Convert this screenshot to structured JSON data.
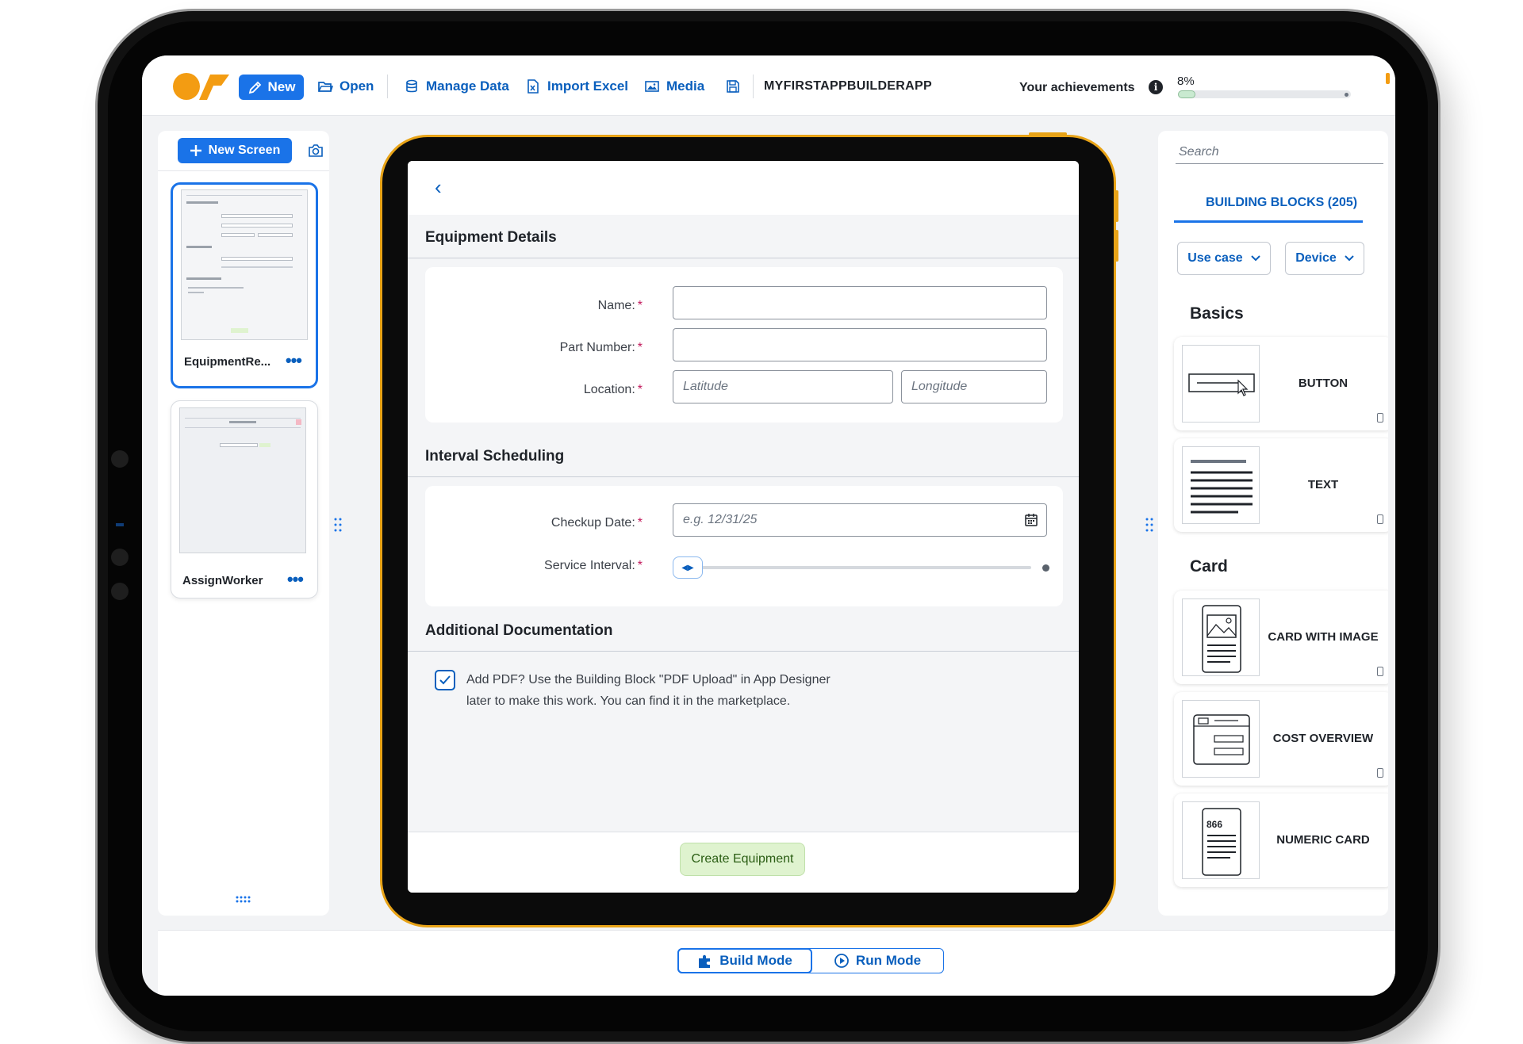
{
  "toolbar": {
    "new_label": "New",
    "open_label": "Open",
    "manage_data_label": "Manage Data",
    "import_excel_label": "Import Excel",
    "media_label": "Media",
    "app_name": "MYFIRSTAPPBUILDERAPP",
    "achievements_label": "Your achievements",
    "achievements_info": "i",
    "achievements_percent": "8%",
    "achievements_progress": 0.08
  },
  "screens_panel": {
    "new_screen_label": "New Screen",
    "screens": [
      {
        "name": "EquipmentRe...",
        "more": "•••",
        "selected": true
      },
      {
        "name": "AssignWorker",
        "more": "•••",
        "selected": false
      }
    ]
  },
  "preview": {
    "back_icon": "‹",
    "sections": {
      "equipment_title": "Equipment Details",
      "interval_title": "Interval Scheduling",
      "documentation_title": "Additional Documentation"
    },
    "fields": {
      "name_label": "Name:",
      "part_number_label": "Part Number:",
      "location_label": "Location:",
      "latitude_placeholder": "Latitude",
      "longitude_placeholder": "Longitude",
      "checkup_date_label": "Checkup Date:",
      "checkup_date_placeholder": "e.g. 12/31/25",
      "service_interval_label": "Service Interval:",
      "required_mark": "*"
    },
    "documentation": {
      "checkbox_checked": true,
      "line1": "Add PDF? Use the Building Block \"PDF Upload\" in App Designer",
      "line2": "later to make this work. You can find it in the marketplace."
    },
    "create_button": "Create Equipment"
  },
  "blocks_panel": {
    "search_placeholder": "Search",
    "tab_label": "BUILDING BLOCKS (205)",
    "use_case_label": "Use case",
    "device_label": "Device",
    "categories": {
      "basics": "Basics",
      "card": "Card"
    },
    "blocks": {
      "button": "BUTTON",
      "text": "TEXT",
      "card_with_image": "CARD WITH IMAGE",
      "cost_overview": "COST OVERVIEW",
      "numeric_card": "NUMERIC CARD",
      "numeric_card_value": "866"
    }
  },
  "bottom_bar": {
    "build_mode": "Build Mode",
    "run_mode": "Run Mode"
  },
  "colors": {
    "accent": "#1a73e8",
    "link": "#0a5fbd",
    "device_border": "#e8a317",
    "logo_orange": "#f39c12",
    "required": "#c2185b",
    "create_button_bg": "#dff3cf"
  }
}
